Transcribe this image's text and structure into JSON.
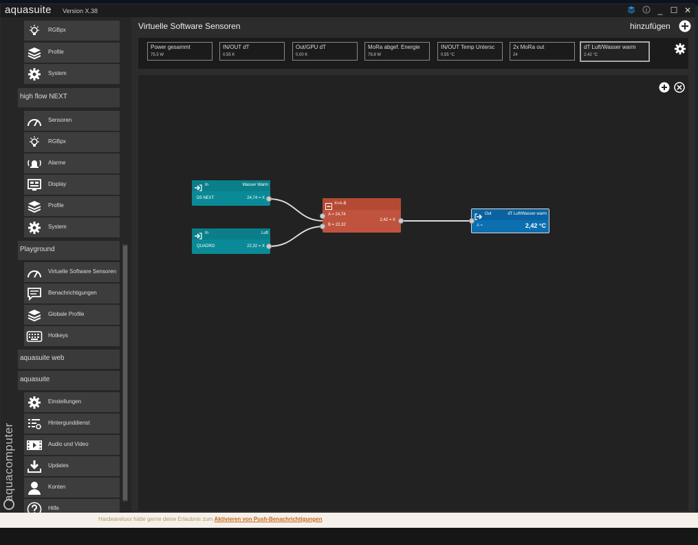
{
  "app": {
    "name": "aquasuite",
    "version": "Version X.38"
  },
  "titlebar": {
    "layers_icon": "layers-icon",
    "info_icon": "info-icon",
    "minimize": "_",
    "maximize": "☐",
    "close": "✕"
  },
  "sidebar": {
    "top_items": [
      {
        "label": "RGBpx",
        "icon": "bulb-icon"
      },
      {
        "label": "Profile",
        "icon": "layers-icon"
      },
      {
        "label": "System",
        "icon": "gear-icon"
      }
    ],
    "groups": [
      {
        "title": "high flow NEXT",
        "items": [
          {
            "label": "Sensoren",
            "icon": "gauge-icon"
          },
          {
            "label": "RGBpx",
            "icon": "bulb-icon"
          },
          {
            "label": "Alarme",
            "icon": "alarm-icon"
          },
          {
            "label": "Display",
            "icon": "display-icon"
          },
          {
            "label": "Profile",
            "icon": "layers-icon"
          },
          {
            "label": "System",
            "icon": "gear-icon"
          }
        ]
      },
      {
        "title": "Playground",
        "items": [
          {
            "label": "Virtuelle Software Sensoren",
            "icon": "gauge-icon"
          },
          {
            "label": "Benachrichtigungen",
            "icon": "message-icon"
          },
          {
            "label": "Globale Profile",
            "icon": "layers-icon"
          },
          {
            "label": "Hotkeys",
            "icon": "keyboard-icon"
          }
        ]
      },
      {
        "title": "aquasuite web",
        "items": []
      },
      {
        "title": "aquasuite",
        "items": [
          {
            "label": "Einstellungen",
            "icon": "gear-icon"
          },
          {
            "label": "Hintergunddienst",
            "icon": "service-icon"
          },
          {
            "label": "Audio und Video",
            "icon": "video-icon"
          },
          {
            "label": "Updates",
            "icon": "download-icon"
          },
          {
            "label": "Konten",
            "icon": "user-icon"
          },
          {
            "label": "Hilfe",
            "icon": "help-icon"
          }
        ]
      }
    ],
    "brand": "aquacomputer"
  },
  "main": {
    "title": "Virtuelle Software Sensoren",
    "add_label": "hinzufügen",
    "tiles": [
      {
        "name": "Power gesammt",
        "value": "75,5 W"
      },
      {
        "name": "IN/OUT dT",
        "value": "0,55 K"
      },
      {
        "name": "Out/GPU dT",
        "value": "0,00 K"
      },
      {
        "name": "MoRa abgef. Energie",
        "value": "79,8 W"
      },
      {
        "name": "IN/OUT Temp Untersc",
        "value": "0,55 °C"
      },
      {
        "name": "2x MoRa out",
        "value": "24"
      },
      {
        "name": "dT Luft/Wasser warm",
        "value": "2,42 °C",
        "selected": true
      }
    ],
    "nodes": {
      "in1": {
        "type": "In",
        "name": "Wasser Warm",
        "source": "D5 NEXT",
        "output": "24,74 = X"
      },
      "in2": {
        "type": "In",
        "name": "Luft",
        "source": "QUADRO",
        "output": "22,32 = X"
      },
      "calc": {
        "formula": "X=A-B",
        "input_a": "A = 24,74",
        "input_b": "B = 22,32",
        "result": "2,42 = X"
      },
      "out": {
        "type": "Out",
        "name": "dT Luft/Wasser warm",
        "input": "A =",
        "value": "2,42 °C"
      }
    }
  },
  "notice": {
    "text": "Hardwareluxx hätte gerne deine Erlaubnis zum ",
    "link": "Aktivieren von Push-Benachrichtigungen",
    "end": "."
  },
  "colors": {
    "input_node": "#0a8a96",
    "calc_node": "#c0533d",
    "output_node": "#0b6fb0",
    "accent": "#1e88d8"
  }
}
